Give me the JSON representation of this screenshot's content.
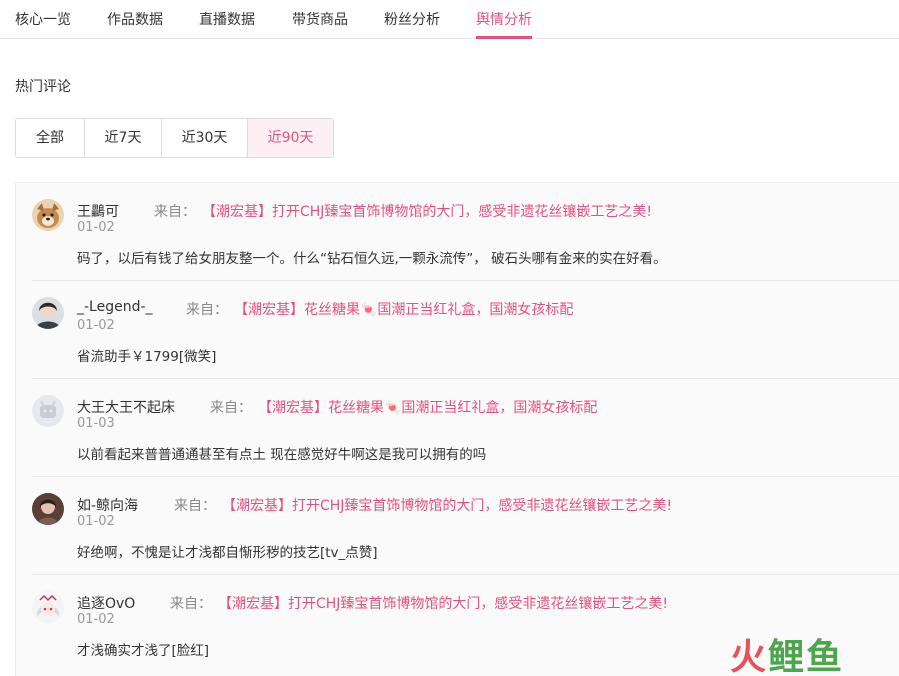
{
  "tabs": [
    {
      "label": "核心一览",
      "active": false
    },
    {
      "label": "作品数据",
      "active": false
    },
    {
      "label": "直播数据",
      "active": false
    },
    {
      "label": "带货商品",
      "active": false
    },
    {
      "label": "粉丝分析",
      "active": false
    },
    {
      "label": "舆情分析",
      "active": true
    }
  ],
  "section_title": "热门评论",
  "range_buttons": [
    {
      "label": "全部",
      "active": false
    },
    {
      "label": "近7天",
      "active": false
    },
    {
      "label": "近30天",
      "active": false
    },
    {
      "label": "近90天",
      "active": true
    }
  ],
  "from_label": "来自：",
  "comments": [
    {
      "user": "王鸓可",
      "date": "01-02",
      "source": "【潮宏基】打开CHJ臻宝首饰博物馆的大门，感受非遗花丝镶嵌工艺之美!",
      "text": "码了，以后有钱了给女朋友整一个。什么“钻石恒久远,一颗永流传”， 破石头哪有金来的实在好看。",
      "avatar_icon": "dog-avatar"
    },
    {
      "user": "_-Legend-_",
      "date": "01-02",
      "source": "【潮宏基】花丝糖果🍬国潮正当红礼盒，国潮女孩标配",
      "text": "省流助手￥1799[微笑]",
      "avatar_icon": "photo-avatar"
    },
    {
      "user": "大王大王不起床",
      "date": "01-03",
      "source": "【潮宏基】花丝糖果🍬国潮正当红礼盒，国潮女孩标配",
      "text": "以前看起来普普通通甚至有点土 现在感觉好牛啊这是我可以拥有的吗",
      "avatar_icon": "default-avatar"
    },
    {
      "user": "如-鲸向海",
      "date": "01-02",
      "source": "【潮宏基】打开CHJ臻宝首饰博物馆的大门，感受非遗花丝镶嵌工艺之美!",
      "text": "好绝啊，不愧是让才浅都自惭形秽的技艺[tv_点赞]",
      "avatar_icon": "photo-avatar"
    },
    {
      "user": "追逐OvO",
      "date": "01-02",
      "source": "【潮宏基】打开CHJ臻宝首饰博物馆的大门，感受非遗花丝镶嵌工艺之美!",
      "text": "才浅确实才浅了[脸红]",
      "avatar_icon": "anime-avatar"
    }
  ],
  "watermark": {
    "part1": "火",
    "part2": "鲤鱼"
  },
  "colors": {
    "accent": "#e94f7d",
    "muted": "#999999",
    "panel_bg": "#fafafa"
  }
}
